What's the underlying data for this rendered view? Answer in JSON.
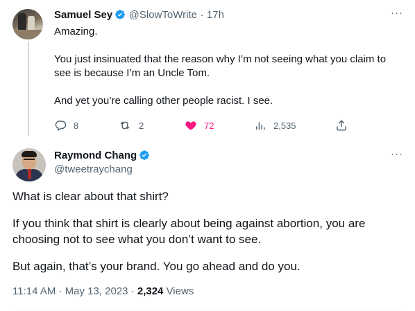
{
  "tweet1": {
    "author_name": "Samuel Sey",
    "handle": "@SlowToWrite",
    "separator": "·",
    "time": "17h",
    "more": "···",
    "body": [
      "Amazing.",
      "You just insinuated that the reason why I’m not seeing what you claim to see is because I’m an Uncle Tom.",
      "And yet you’re calling other people racist. I see."
    ],
    "replies": "8",
    "retweets": "2",
    "likes": "72",
    "views": "2,535",
    "like_color": "#f91880"
  },
  "tweet2": {
    "author_name": "Raymond Chang",
    "handle": "@tweetraychang",
    "more": "···",
    "body": [
      "What is clear about that shirt?",
      "If you think that shirt is clearly about being against abortion, you are choosing not to see what you don’t want to see.",
      "But again, that’s your brand. You go ahead and do you."
    ],
    "time": "11:14 AM",
    "sep1": "·",
    "date": "May 13, 2023",
    "sep2": "·",
    "views_count": "2,324",
    "views_label": "Views"
  },
  "colors": {
    "verified": "#1d9bf0",
    "secondary_text": "#536471",
    "primary_text": "#0f1419"
  }
}
